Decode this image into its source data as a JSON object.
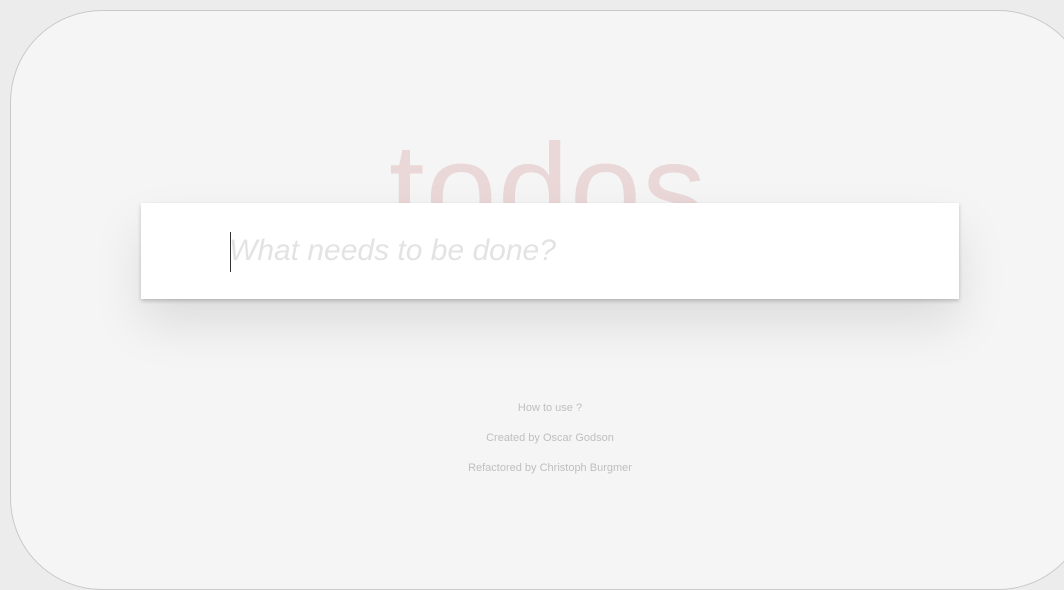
{
  "header": {
    "title": "todos"
  },
  "new_todo": {
    "placeholder": "What needs to be done?",
    "value": ""
  },
  "footer_info": {
    "help_link": "How to use ?",
    "created_by": "Created by Oscar Godson",
    "refactored_by": "Refactored by Christoph Burgmer"
  },
  "colors": {
    "title": "#efd5d5",
    "page_background": "#f5f5f5",
    "input_background": "#ffffff",
    "placeholder": "#e3e3e3",
    "footer_text": "#bfbfbf"
  }
}
